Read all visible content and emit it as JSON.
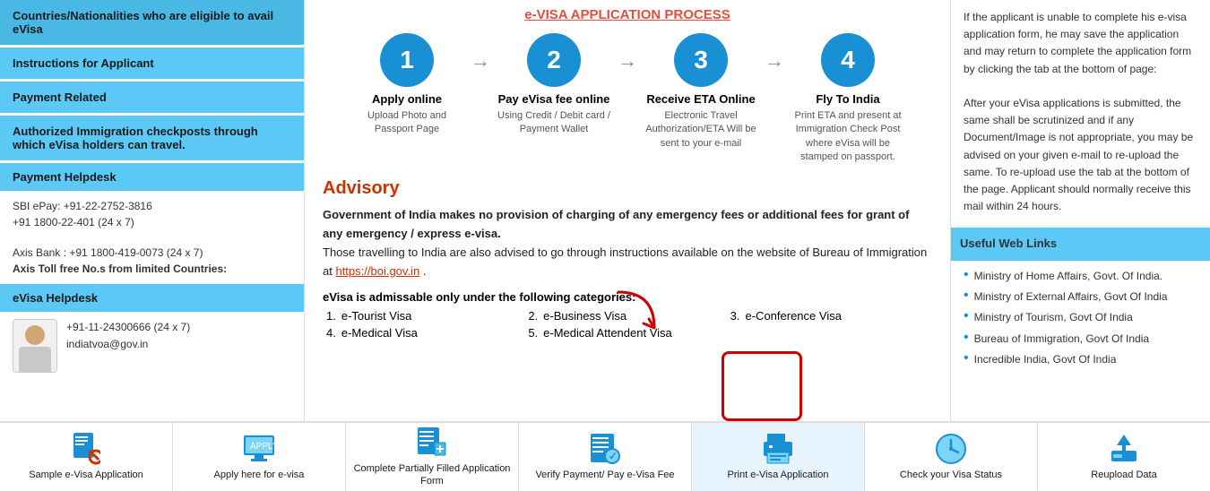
{
  "sidebar": {
    "items": [
      {
        "id": "countries",
        "label": "Countries/Nationalities who are eligible to avail eVisa"
      },
      {
        "id": "instructions",
        "label": "Instructions for Applicant"
      },
      {
        "id": "payment",
        "label": "Payment Related"
      },
      {
        "id": "immigration",
        "label": "Authorized Immigration checkposts through which eVisa holders can travel."
      }
    ],
    "payment_helpdesk": "Payment Helpdesk",
    "evisa_helpdesk": "eVisa Helpdesk",
    "sbi_text": "SBI ePay: +91-22-2752-3816",
    "sbi_toll": "+91 1800-22-401 (24 x 7)",
    "axis_text": "Axis Bank : +91 1800-419-0073 (24 x 7)",
    "axis_toll": "Axis Toll free No.s from limited Countries:",
    "helpdesk_phone": "+91-11-24300666 (24 x 7)",
    "helpdesk_email": "indiatvoa@gov.in"
  },
  "process": {
    "title": "e-VISA APPLICATION PROCESS",
    "steps": [
      {
        "number": "1",
        "title": "Apply online",
        "subtitle": "Upload Photo and Passport Page"
      },
      {
        "number": "2",
        "title": "Pay eVisa fee online",
        "subtitle": "Using Credit / Debit card / Payment Wallet"
      },
      {
        "number": "3",
        "title": "Receive ETA Online",
        "subtitle": "Electronic Travel Authorization/ETA Will be sent to your e-mail"
      },
      {
        "number": "4",
        "title": "Fly To India",
        "subtitle": "Print ETA and present at Immigration Check Post where eVisa will be stamped on passport."
      }
    ]
  },
  "advisory": {
    "title": "Advisory",
    "text1": "Government of India makes no provision of charging of any emergency fees or additional fees for grant of any emergency / express e-visa.",
    "text2": "Those travelling to India are also advised to go through instructions available on the website of Bureau of Immigration at",
    "link": "https://boi.gov.in",
    "text3": ".",
    "categories_title": "eVisa is admissable only under the following categories:",
    "categories": [
      {
        "num": "1.",
        "label": "e-Tourist Visa"
      },
      {
        "num": "2.",
        "label": "e-Business Visa"
      },
      {
        "num": "3.",
        "label": "e-Conference Visa"
      },
      {
        "num": "4.",
        "label": "e-Medical Visa"
      },
      {
        "num": "5.",
        "label": "e-Medical Attendent Visa"
      }
    ]
  },
  "right_panel": {
    "intro_text": "If the applicant is unable to complete his e-visa application form, he may save the application and may return to complete the application form by clicking the tab at the bottom of page:",
    "after_submit": "After your eVisa applications is submitted, the same shall be scrutinized and if any Document/Image is not appropriate, you may be advised on your given e-mail to re-upload the same. To re-upload use the tab at the bottom of the page. Applicant should normally receive this mail within 24 hours.",
    "useful_links_title": "Useful Web Links",
    "links": [
      "Ministry of Home Affairs, Govt. Of India.",
      "Ministry of External Affairs, Govt Of India",
      "Ministry of Tourism, Govt Of India",
      "Bureau of Immigration, Govt Of India",
      "Incredible India, Govt Of India"
    ]
  },
  "bottom_bar": {
    "items": [
      {
        "id": "sample",
        "label": "Sample e-Visa Application",
        "icon": "document-icon"
      },
      {
        "id": "apply",
        "label": "Apply here for e-visa",
        "icon": "screen-icon"
      },
      {
        "id": "complete",
        "label": "Complete Partially Filled Application Form",
        "icon": "form-icon"
      },
      {
        "id": "verify",
        "label": "Verify Payment/ Pay e-Visa Fee",
        "icon": "list-icon"
      },
      {
        "id": "print",
        "label": "Print e-Visa Application",
        "icon": "print-icon"
      },
      {
        "id": "check",
        "label": "Check your Visa Status",
        "icon": "clock-icon"
      },
      {
        "id": "reupload",
        "label": "Reupload Data",
        "icon": "upload-icon"
      }
    ]
  }
}
